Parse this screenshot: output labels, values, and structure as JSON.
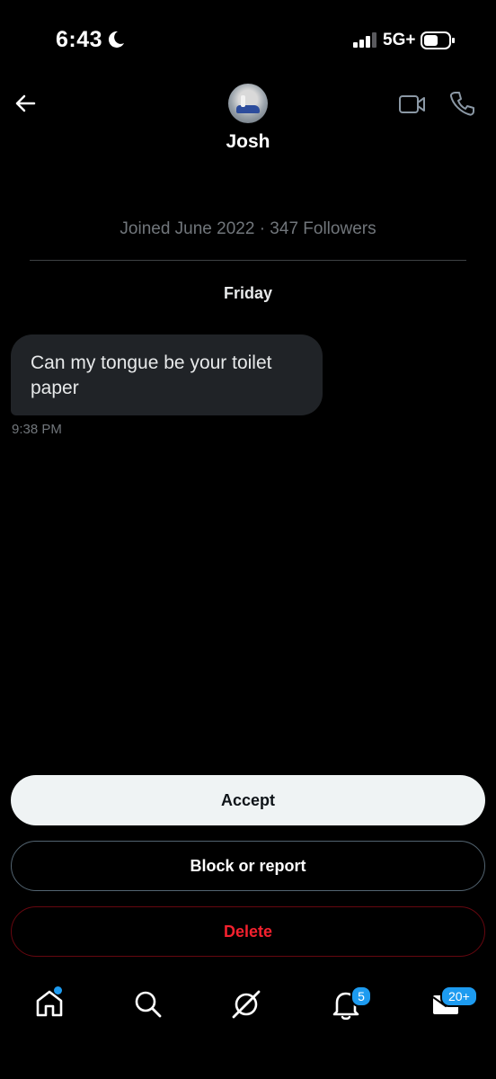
{
  "status_bar": {
    "time": "6:43",
    "network": "5G+"
  },
  "header": {
    "name": "Josh"
  },
  "profile": {
    "joined": "Joined June 2022 · 347 Followers"
  },
  "conversation": {
    "day": "Friday",
    "messages": [
      {
        "text": "Can my tongue be your toilet paper",
        "time": "9:38 PM"
      }
    ]
  },
  "actions": {
    "accept": "Accept",
    "block": "Block or report",
    "delete": "Delete"
  },
  "nav": {
    "notifications_badge": "5",
    "messages_badge": "20+"
  },
  "colors": {
    "accent": "#1d9bf0",
    "danger": "#f4212e",
    "bubble": "#202327",
    "muted": "#71767b"
  }
}
